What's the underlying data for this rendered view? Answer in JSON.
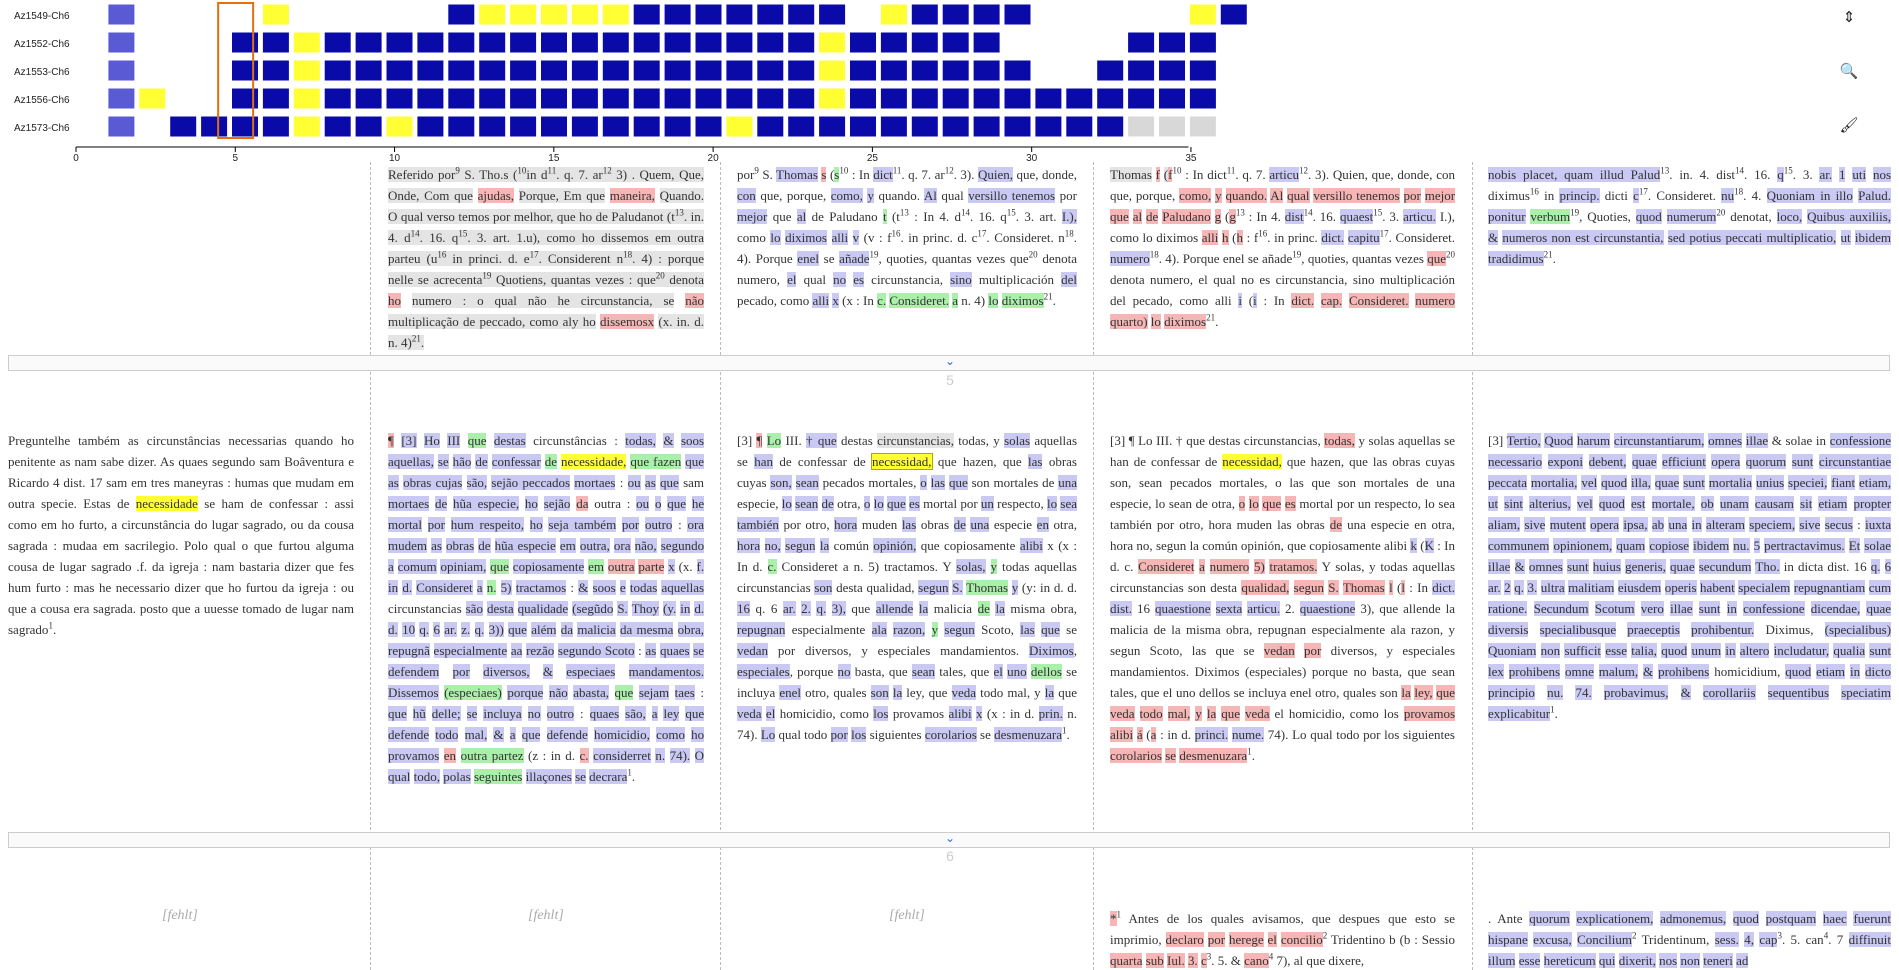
{
  "chart_data": {
    "type": "heatmap",
    "rows": [
      "Az1549-Ch6",
      "Az1552-Ch6",
      "Az1553-Ch6",
      "Az1556-Ch6",
      "Az1573-Ch6"
    ],
    "columns": 36,
    "x_ticks": [
      0,
      5,
      10,
      15,
      20,
      25,
      30,
      35
    ],
    "selected_column": 5,
    "legend": {
      "B": "dark blue",
      "b": "light blue",
      "Y": "yellow",
      "G": "grey",
      "-": "empty"
    },
    "cells": [
      "-b----Y-----BYYYYYBBBBBBB-YBBBB-----YB",
      "-b---BBYBBBBBBBBBBBBBBBBYBBBBB----BBB",
      "-b---BBYBBBBBBBBBBBBBBBBYBBBBBB--BBBB",
      "-bY--BBYBBBBBBBBBBBBBBBBYBBBBBBBBBBBB",
      "-b-BBBBYBBYBBBBBBBBBBYBBBBBBBBBBBBGGG"
    ],
    "colors": {
      "B": "#0a0aa8",
      "b": "#5a5ad4",
      "Y": "#ffff33",
      "G": "#d8d8d8",
      "selected_border": "#e07010"
    }
  },
  "tools": {
    "expand": "⇕",
    "search": "🔍",
    "brush": "🖌"
  },
  "sections": [
    {
      "num": "5"
    },
    {
      "num": "6"
    }
  ],
  "fehlt": "[fehlt]"
}
